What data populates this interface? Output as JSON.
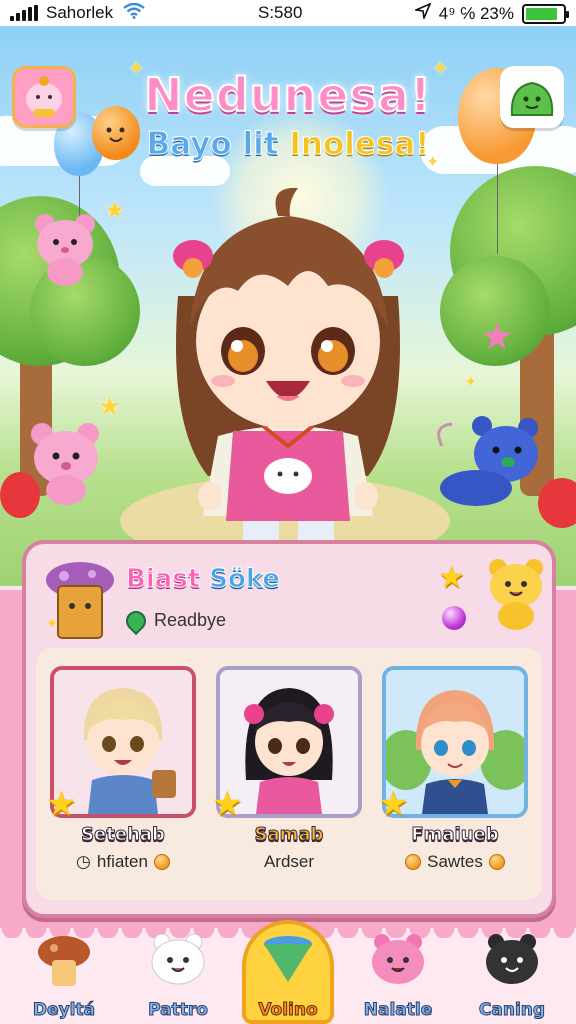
{
  "status_bar": {
    "carrier": "Sahorlek",
    "time": "S:580",
    "right_text": "4⁹ ℅ 23%",
    "battery_level": 0.85
  },
  "header": {
    "title": "Nedunesa!",
    "subtitle_part1": "Bayo lit",
    "subtitle_part2": "Inolesa!"
  },
  "character_panel": {
    "name_part1": "Biast",
    "name_part2": "Söke",
    "status": "Readbye"
  },
  "cards": [
    {
      "name": "Setehab",
      "detail": "hfiaten",
      "frame_color": "#c94f6a",
      "name_color": "#ffffff"
    },
    {
      "name": "Samab",
      "detail": "Ardser",
      "frame_color": "#a9a0c9",
      "name_color": "#ffb53a"
    },
    {
      "name": "Fmaiueb",
      "detail": "Sawtes",
      "frame_color": "#6fb3e6",
      "name_color": "#ffffff"
    }
  ],
  "bottom_nav": [
    {
      "label": "Deyltá",
      "icon": "mushroom-icon",
      "active": false
    },
    {
      "label": "Pattro",
      "icon": "bear-icon",
      "active": false
    },
    {
      "label": "Volino",
      "icon": "cup-icon",
      "active": true
    },
    {
      "label": "Nalatle",
      "icon": "pink-bear-icon",
      "active": false
    },
    {
      "label": "Caning",
      "icon": "black-cat-icon",
      "active": false
    }
  ],
  "colors": {
    "accent_pink": "#ff5fb4",
    "panel_border": "#d7809f",
    "active_tab": "#ffd23f"
  }
}
